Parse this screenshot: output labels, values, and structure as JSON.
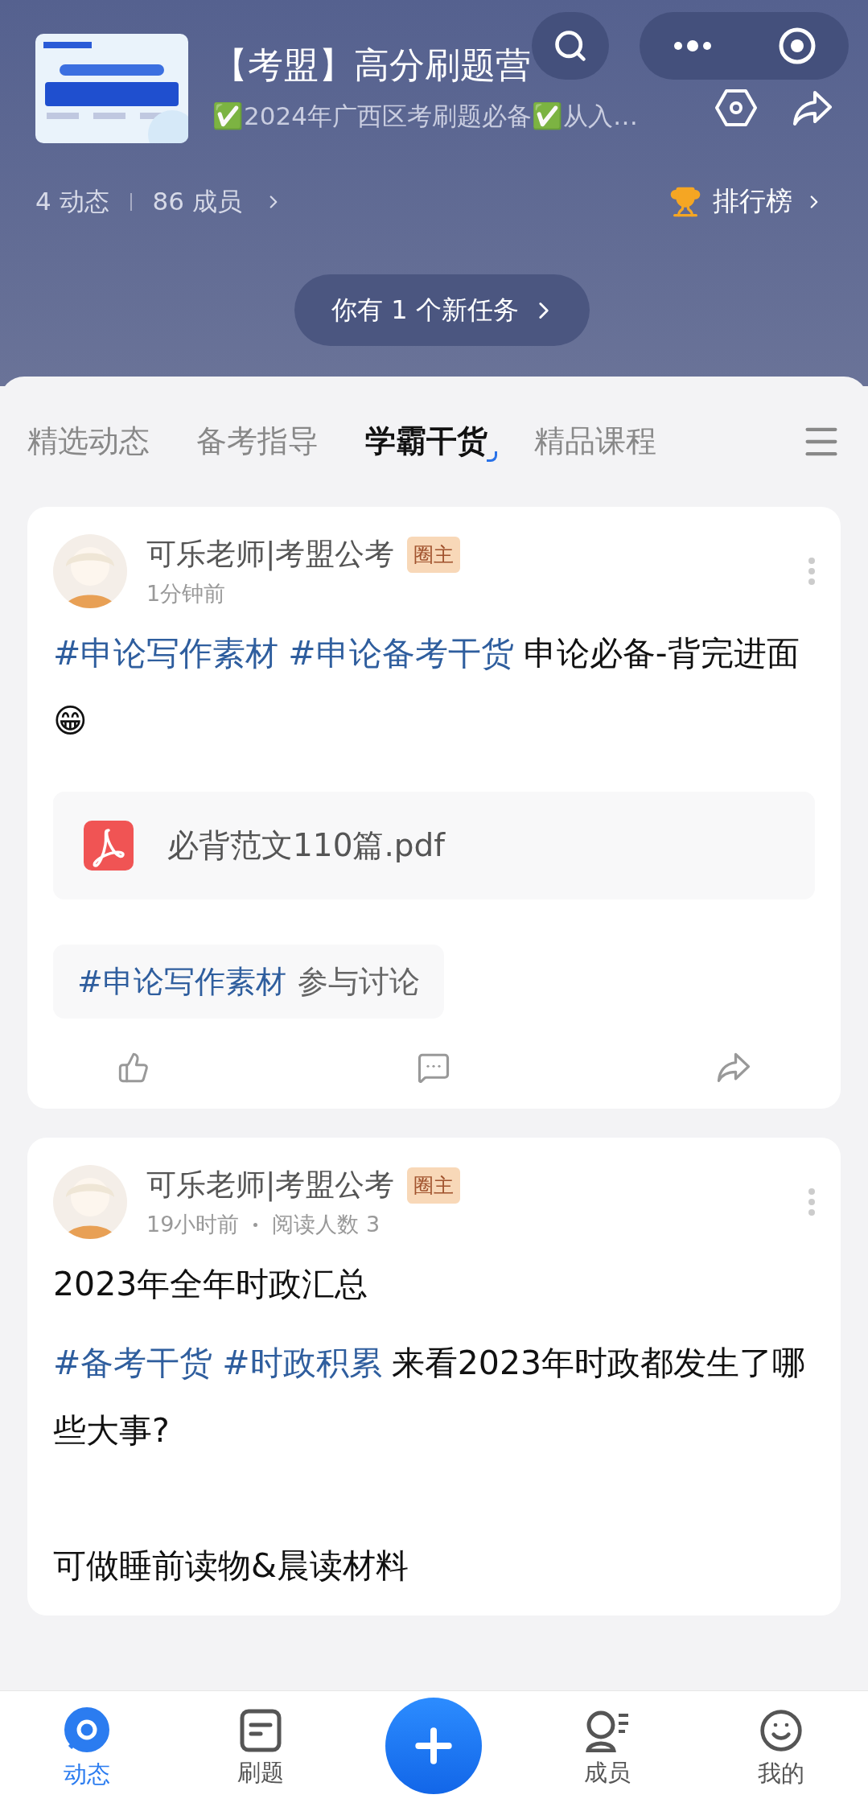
{
  "header": {
    "title": "【考盟】高分刷题营",
    "subtitle": "✅2024年广西区考刷题必备✅从入…",
    "stats": [
      "4 动态",
      "86 成员"
    ],
    "ranking": "排行榜",
    "task_banner": "你有 1 个新任务"
  },
  "tabs": [
    {
      "label": "精选动态",
      "selected": false
    },
    {
      "label": "备考指导",
      "selected": false
    },
    {
      "label": "学霸干货",
      "selected": true
    },
    {
      "label": "精品课程",
      "selected": false
    }
  ],
  "posts": [
    {
      "author": "可乐老师|考盟公考",
      "badge": "圈主",
      "meta": [
        "1分钟前"
      ],
      "sections": [
        [
          {
            "tags": [
              "#申论写作素材",
              "#申论备考干货"
            ],
            "text": "申论必备-背完进面😁"
          }
        ]
      ],
      "attachment": "必背范文110篇.pdf",
      "topic": {
        "tag": "#申论写作素材",
        "action": "参与讨论"
      }
    },
    {
      "author": "可乐老师|考盟公考",
      "badge": "圈主",
      "meta": [
        "19小时前",
        "阅读人数 3"
      ],
      "sections": [
        [
          {
            "text": "2023年全年时政汇总"
          },
          {
            "tags": [
              "#备考干货",
              "#时政积累"
            ],
            "text": "来看2023年时政都发生了哪些大事?"
          }
        ],
        [
          {
            "text": "可做睡前读物&晨读材料"
          }
        ]
      ]
    }
  ],
  "nav": [
    {
      "kind": "chat",
      "label": "动态",
      "selected": true
    },
    {
      "kind": "quiz",
      "label": "刷题",
      "selected": false
    },
    {
      "kind": "add"
    },
    {
      "kind": "members",
      "label": "成员",
      "selected": false
    },
    {
      "kind": "me",
      "label": "我的",
      "selected": false
    }
  ]
}
